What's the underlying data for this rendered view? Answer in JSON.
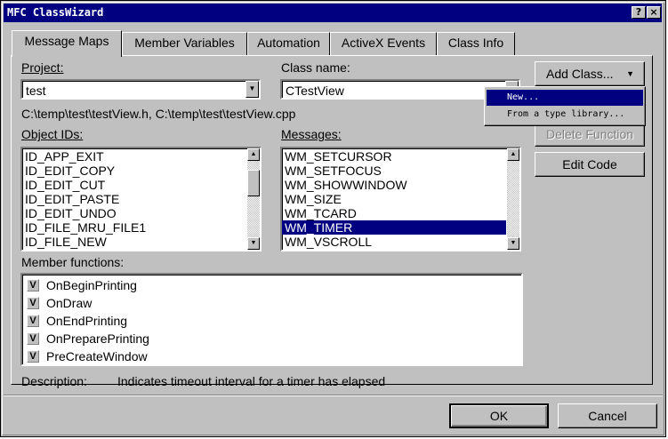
{
  "window": {
    "title": "MFC ClassWizard",
    "help_glyph": "?",
    "close_glyph": "×"
  },
  "tabs": [
    {
      "label": "Message Maps"
    },
    {
      "label": "Member Variables"
    },
    {
      "label": "Automation"
    },
    {
      "label": "ActiveX Events"
    },
    {
      "label": "Class Info"
    }
  ],
  "project": {
    "label": "Project:",
    "value": "test"
  },
  "class_name": {
    "label": "Class name:",
    "value": "CTestView"
  },
  "file_path": "C:\\temp\\test\\testView.h, C:\\temp\\test\\testView.cpp",
  "object_ids": {
    "label": "Object IDs:",
    "items": [
      "ID_APP_EXIT",
      "ID_EDIT_COPY",
      "ID_EDIT_CUT",
      "ID_EDIT_PASTE",
      "ID_EDIT_UNDO",
      "ID_FILE_MRU_FILE1",
      "ID_FILE_NEW"
    ]
  },
  "messages": {
    "label": "Messages:",
    "items": [
      "WM_SETCURSOR",
      "WM_SETFOCUS",
      "WM_SHOWWINDOW",
      "WM_SIZE",
      "WM_TCARD",
      "WM_TIMER",
      "WM_VSCROLL"
    ],
    "selected": "WM_TIMER"
  },
  "member_functions": {
    "label": "Member functions:",
    "badge": "V",
    "items": [
      "OnBeginPrinting",
      "OnDraw",
      "OnEndPrinting",
      "OnPreparePrinting",
      "PreCreateWindow"
    ]
  },
  "description": {
    "label": "Description:",
    "text": "Indicates timeout interval for a timer has elapsed"
  },
  "buttons": {
    "add_class": "Add Class...",
    "delete_function": "Delete Function",
    "edit_code": "Edit Code",
    "ok": "OK",
    "cancel": "Cancel"
  },
  "add_class_menu": {
    "items": [
      "New...",
      "From a type library..."
    ],
    "highlighted": "New..."
  },
  "icons": {
    "combo_arrow": "triangle-down",
    "scroll_up": "triangle-up",
    "scroll_down": "triangle-down"
  },
  "colors": {
    "face": "#c0c0c0",
    "selection": "#000080",
    "title_bar": "#000080"
  }
}
